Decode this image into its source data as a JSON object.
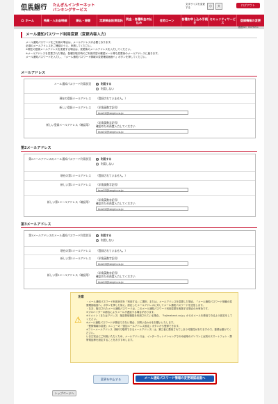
{
  "header": {
    "bank_name": "但馬銀行",
    "bank_name_roman": "TAJIMA BANK",
    "service_line1": "たんぎんインターネット",
    "service_line2": "バンキングサービス",
    "font_size_label": "文字サイズを変更する",
    "font_size_small": "小",
    "font_size_large": "大",
    "logout": "ログアウト"
  },
  "nav": [
    {
      "label": "ホーム",
      "icon": "home-icon"
    },
    {
      "label": "残高・入出金明細",
      "icon": "passbook-icon"
    },
    {
      "label": "振込・振替",
      "icon": "transfer-icon"
    },
    {
      "label": "定期預金投資信託",
      "icon": "deposit-icon"
    },
    {
      "label": "税金・各種料金の払込み",
      "icon": "payment-icon"
    },
    {
      "label": "住宅ローン",
      "icon": "house-icon"
    },
    {
      "label": "各種お申し込み手続き",
      "icon": "form-icon"
    },
    {
      "label": "セキュリティサービス",
      "icon": "lock-icon"
    },
    {
      "label": "登録情報の変更",
      "icon": "gear-icon"
    }
  ],
  "screen_id": "画面ID：BOH001",
  "page_title": "メール通知パスワード利用変更（変更内容入力）",
  "intro_lines": [
    "メール通知パスワードをご利用の場合は、メールアドレスが必要となります。",
    "必須のメールアドレスをご確認のうえ、申請してください。",
    "※現在の登録メールアドレスを変更する場合は、変更後のメールアドレスを入力してください。",
    "※メールアドレスを変更された場合、各種お取引時のご利用内容の確認メール等も変更後のメールアドレスに届きます。",
    "メール通知パスワードを入力し、「メール通知パスワード情報の変更確認画面へ」ボタンを押してください。"
  ],
  "sections": [
    {
      "title": "メールアドレス",
      "status_label": "メール通知パスワード利用状況",
      "opt_use": "利用する",
      "opt_nouse": "利用しない",
      "current_label": "現在の登録メールアドレス",
      "current_value": "（登録されていません。）",
      "new_label": "新しい登録メールアドレス",
      "note_halfwidth": "（半角英数字記号）",
      "new_value": "taro01@tangin.co.jp",
      "confirm_label": "新しい登録メールアドレス（確認用）",
      "confirm_hint": "確認のため再度入力してください",
      "confirm_value": "taro01@tangin.co.jp"
    },
    {
      "title": "第2メールアドレス",
      "status_label": "第2メールアドレスのメール通知パスワード利用状況",
      "opt_use": "利用する",
      "opt_nouse": "利用しない",
      "current_label": "現在の第2メールアドレス",
      "current_value": "（登録されていません。）",
      "new_label": "新しい第2メールアドレス",
      "note_halfwidth": "（半角英数字記号）",
      "new_value": "taro02@tangin.co.jp",
      "confirm_label": "新しい第2メールアドレス（確認用）",
      "confirm_hint": "確認のため再度入力してください",
      "confirm_value": "taro02@tangin.co.jp"
    },
    {
      "title": "第3メールアドレス",
      "status_label": "第3メールアドレスのメール通知パスワード利用状況",
      "opt_use": "利用する",
      "opt_nouse": "利用しない",
      "current_label": "現在の第3メールアドレス",
      "current_value": "（登録されていません。）",
      "new_label": "新しい第3メールアドレス",
      "note_halfwidth": "（半角英数字記号）",
      "new_value": "taro03@tangin.co.jp",
      "confirm_label": "新しい第3メールアドレス（確認用）",
      "confirm_hint": "確認のため再度入力してください",
      "confirm_value": "taro03@tangin.co.jp"
    }
  ],
  "notice": {
    "title": "注意",
    "items": [
      "・メール通知パスワード利用状況を「利用する」に選択、または、メールアドレスを変更した場合、「メール通知パスワード情報の変更確認画面へ」ボタンを押した後に、設定したメールアドレスに対してメール通知パスワードを送信します。",
      "・なお、取引されたメール通知パスワードは、このメール通知パスワード利用変更を実施する場合のみ有効です。",
      "※プロバイダーの都合によりメールが遅延する場合があります。",
      "※ドメイン（またはアドレス）指定受信機能を利用されている場合、「tajimabank.co.jp」からのメールを受信できるよう設定をしてください。",
      "※メール通知パスワードが受信できない場合、お問い合わせをお願いいたします。",
      "「登録情報の変更」メニューの「追加メールアドレス設定」ボタンから登録できます。",
      "※フリーメールアドレス（無料で取得できるメールアドレス）は、第三者に悪用されてしまう可能性がありますので、登録は避けてください。",
      "いまだ安全にご利用いただくため、メールアドレスは、インターネットバンキングでのみ使用のパソコンとは別のスマートフォン・携帯電話等を設定することをおすすめします。"
    ]
  },
  "buttons": {
    "cancel": "変更を中止する",
    "confirm": "メール通知パスワード情報の変更確認画面へ",
    "top": "トップページへ"
  },
  "colors": {
    "brand_red": "#c8102e",
    "confirm_blue": "#1a57b0",
    "notice_bg": "#fff6c8"
  }
}
